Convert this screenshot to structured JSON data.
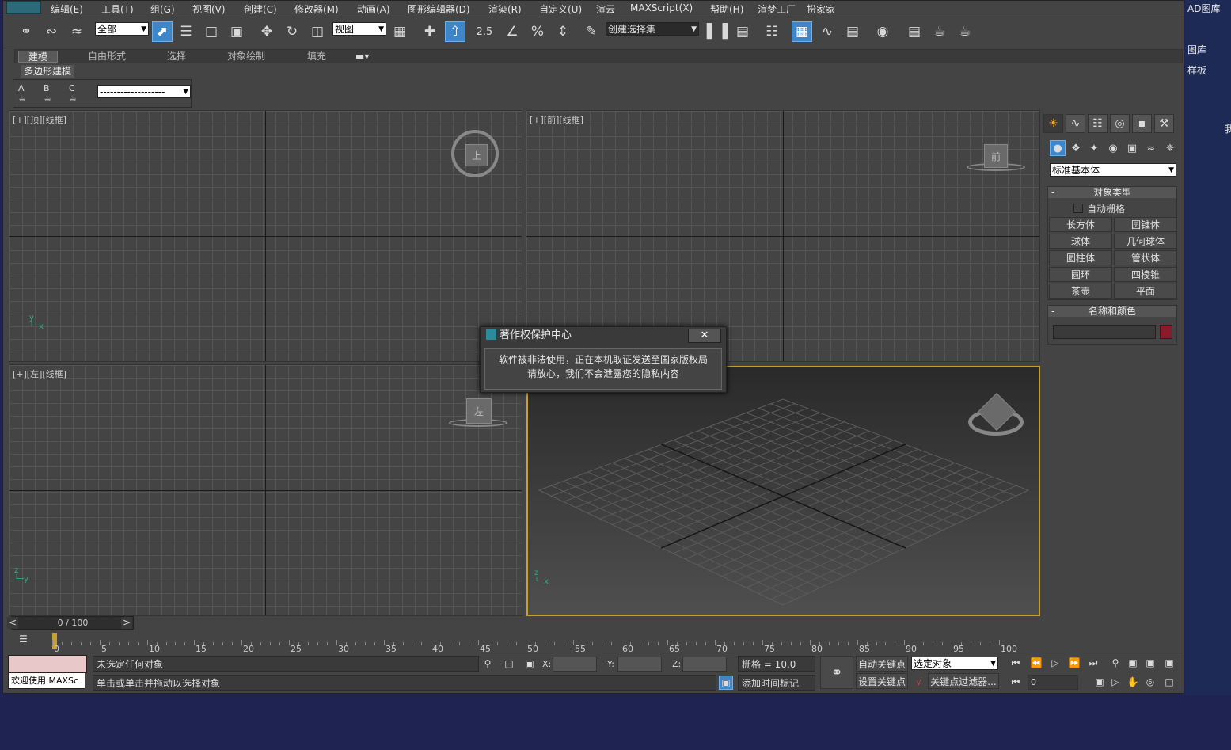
{
  "menu": [
    "编辑(E)",
    "工具(T)",
    "组(G)",
    "视图(V)",
    "创建(C)",
    "修改器(M)",
    "动画(A)",
    "图形编辑器(D)",
    "渲染(R)",
    "自定义(U)",
    "渲云",
    "MAXScript(X)",
    "帮助(H)",
    "渲梦工厂",
    "扮家家"
  ],
  "toolbar": {
    "selection_filter": "全部",
    "ref_coord": "视图",
    "snap_label": "2.5",
    "angle_snap": "%",
    "named_selection": "创建选择集"
  },
  "ribbon": {
    "tabs": [
      "建模",
      "自由形式",
      "选择",
      "对象绘制",
      "填充"
    ],
    "panel_label": "多边形建模",
    "teapots": [
      "A",
      "B",
      "C"
    ],
    "dropdown": "-------------------"
  },
  "viewports": {
    "top": {
      "label": "[+][顶][线框]",
      "cube": "上"
    },
    "front": {
      "label": "[+][前][线框]",
      "cube": "前"
    },
    "left": {
      "label": "[+][左][线框]",
      "cube": "左"
    }
  },
  "dialog": {
    "title": "著作权保护中心",
    "close": "✕",
    "line1": "软件被非法使用，正在本机取证发送至国家版权局",
    "line2": "请放心，我们不会泄露您的隐私内容"
  },
  "command_panel": {
    "category": "标准基本体",
    "object_type_title": "对象类型",
    "autogrid": "自动栅格",
    "buttons": [
      "长方体",
      "圆锥体",
      "球体",
      "几何球体",
      "圆柱体",
      "管状体",
      "圆环",
      "四棱锥",
      "茶壶",
      "平面"
    ],
    "name_color_title": "名称和颜色",
    "object_color": "#8b1a2b"
  },
  "timeline": {
    "slider": "0 / 100",
    "prev": "<",
    "next": ">",
    "ticks": [
      "0",
      "5",
      "10",
      "15",
      "20",
      "25",
      "30",
      "35",
      "40",
      "45",
      "50",
      "55",
      "60",
      "65",
      "70",
      "75",
      "80",
      "85",
      "90",
      "95",
      "100"
    ]
  },
  "status": {
    "welcome": "欢迎使用 MAXSc",
    "selection": "未选定任何对象",
    "prompt": "单击或单击并拖动以选择对象",
    "x_label": "X:",
    "y_label": "Y:",
    "z_label": "Z:",
    "grid": "栅格 = 10.0",
    "add_time_tag": "添加时间标记",
    "auto_key": "自动关键点",
    "set_key": "设置关键点",
    "key_mode": "选定对象",
    "key_filters": "关键点过滤器...",
    "frame": "0"
  },
  "desktop": {
    "items": [
      "AD图库",
      "图库",
      "样板",
      "我"
    ]
  }
}
